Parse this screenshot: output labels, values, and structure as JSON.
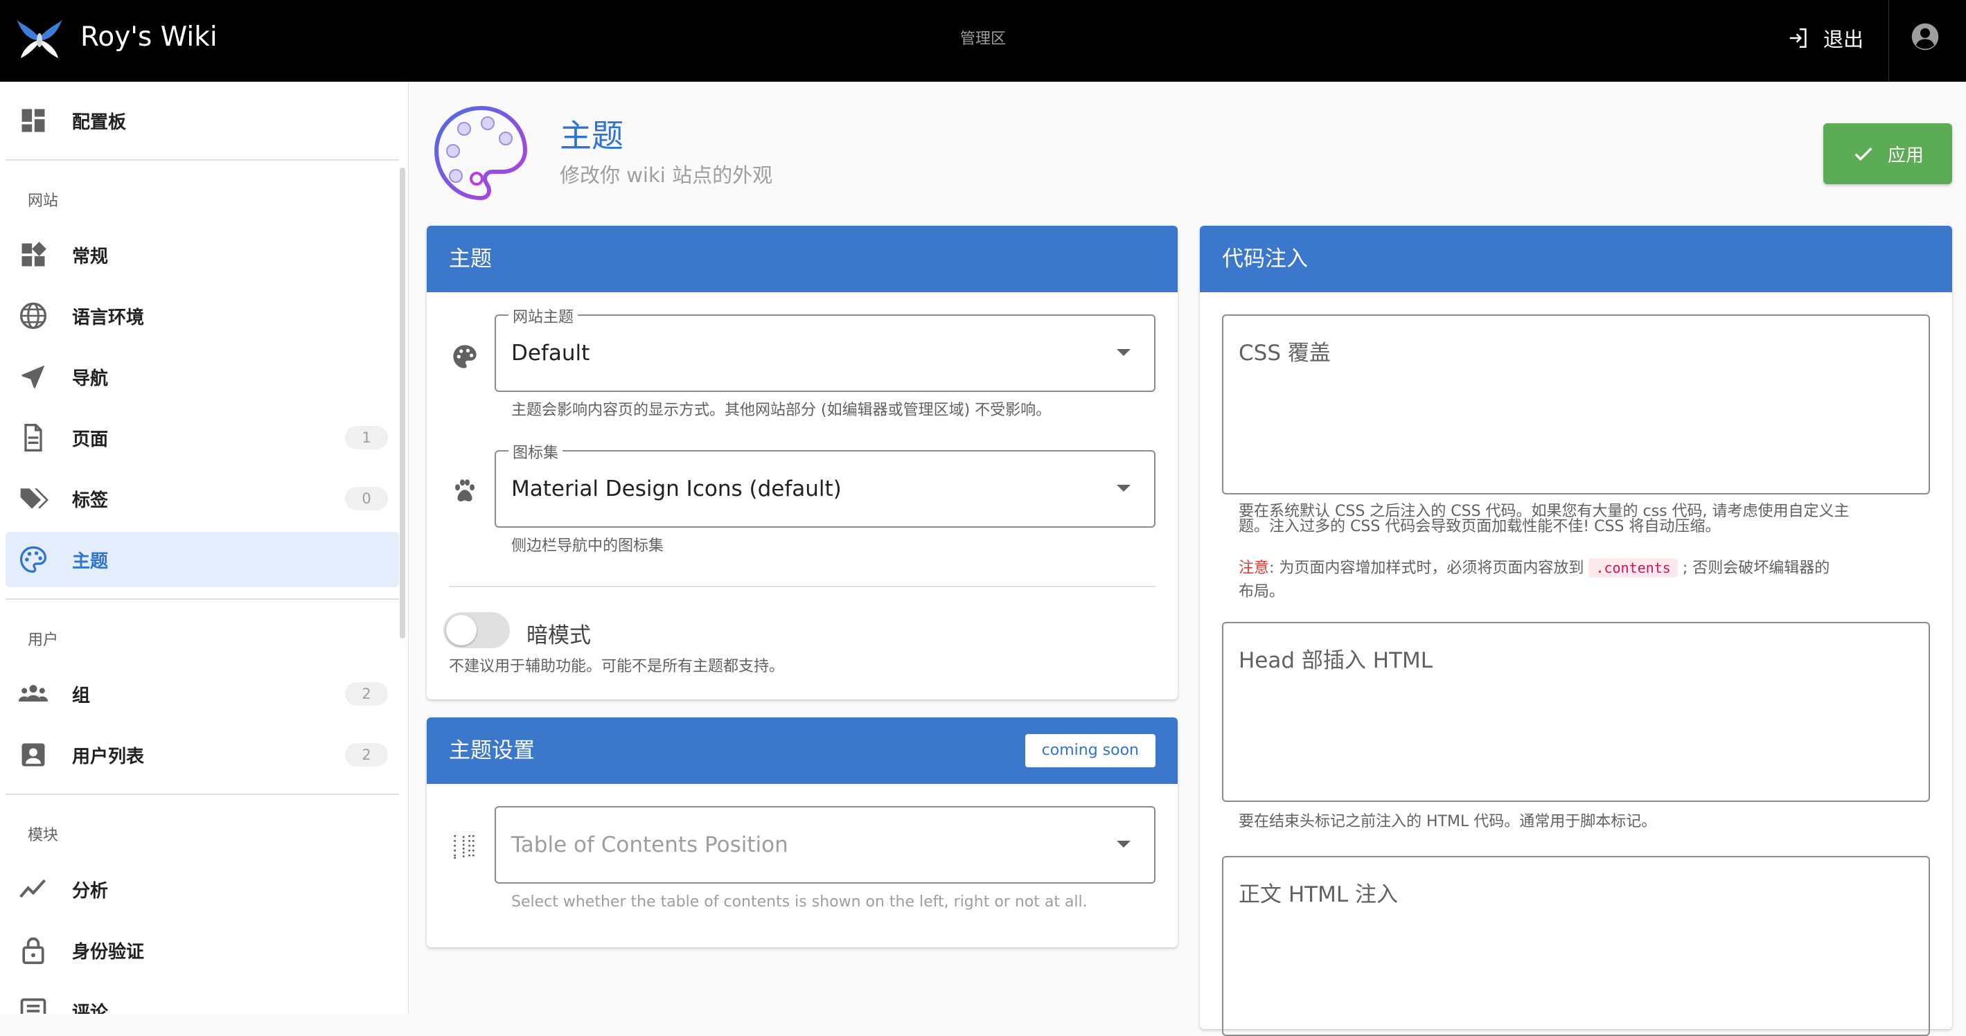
{
  "topbar": {
    "brand": "Roy's Wiki",
    "center_title": "管理区",
    "logout_label": "退出"
  },
  "sidebar": {
    "dashboard": "配置板",
    "section_site": "网站",
    "items_site": [
      {
        "label": "常规",
        "icon": "widgets-icon"
      },
      {
        "label": "语言环境",
        "icon": "globe-icon"
      },
      {
        "label": "导航",
        "icon": "navigation-icon"
      },
      {
        "label": "页面",
        "icon": "page-icon",
        "badge": "1"
      },
      {
        "label": "标签",
        "icon": "tags-icon",
        "badge": "0"
      },
      {
        "label": "主题",
        "icon": "palette-icon",
        "active": true
      }
    ],
    "section_users": "用户",
    "items_users": [
      {
        "label": "组",
        "icon": "group-icon",
        "badge": "2"
      },
      {
        "label": "用户列表",
        "icon": "user-list-icon",
        "badge": "2"
      }
    ],
    "section_modules": "模块",
    "items_modules": [
      {
        "label": "分析",
        "icon": "analytics-icon"
      },
      {
        "label": "身份验证",
        "icon": "lock-icon"
      },
      {
        "label": "评论",
        "icon": "comments-icon"
      }
    ]
  },
  "header": {
    "title": "主题",
    "subtitle": "修改你 wiki 站点的外观",
    "apply_label": "应用"
  },
  "theme_card": {
    "title": "主题",
    "site_theme": {
      "legend": "网站主题",
      "value": "Default",
      "hint": "主题会影响内容页的显示方式。其他网站部分 (如编辑器或管理区域) 不受影响。"
    },
    "icon_set": {
      "legend": "图标集",
      "value": "Material Design Icons (default)",
      "hint": "侧边栏导航中的图标集"
    },
    "dark_mode": {
      "label": "暗模式",
      "hint": "不建议用于辅助功能。可能不是所有主题都支持。",
      "enabled": false
    }
  },
  "theme_settings_card": {
    "title": "主题设置",
    "badge": "coming soon",
    "toc": {
      "placeholder": "Table of Contents Position",
      "hint": "Select whether the table of contents is shown on the left, right or not at all."
    }
  },
  "code_card": {
    "title": "代码注入",
    "css": {
      "label": "CSS 覆盖",
      "hint_line1": "要在系统默认 CSS 之后注入的 CSS 代码。如果您有大量的 css 代码, 请考虑使用自定义主",
      "hint_line2": "题。注入过多的 CSS 代码会导致页面加载性能不佳! CSS 将自动压缩。",
      "note_prefix": "注意",
      "note_mid": ": 为页面内容增加样式时，必须将页面内容放到",
      "note_code": ".contents",
      "note_suffix": "; 否则会破坏编辑器的",
      "note_line2": "布局。"
    },
    "head": {
      "label": "Head 部插入 HTML",
      "hint": "要在结束头标记之前注入的 HTML 代码。通常用于脚本标记。"
    },
    "body": {
      "label": "正文 HTML 注入"
    }
  },
  "colors": {
    "topbar": "#000000",
    "accent": "#3b78cc",
    "active_bg": "#e3edfb",
    "apply": "#5cab55",
    "note": "#e53935"
  }
}
